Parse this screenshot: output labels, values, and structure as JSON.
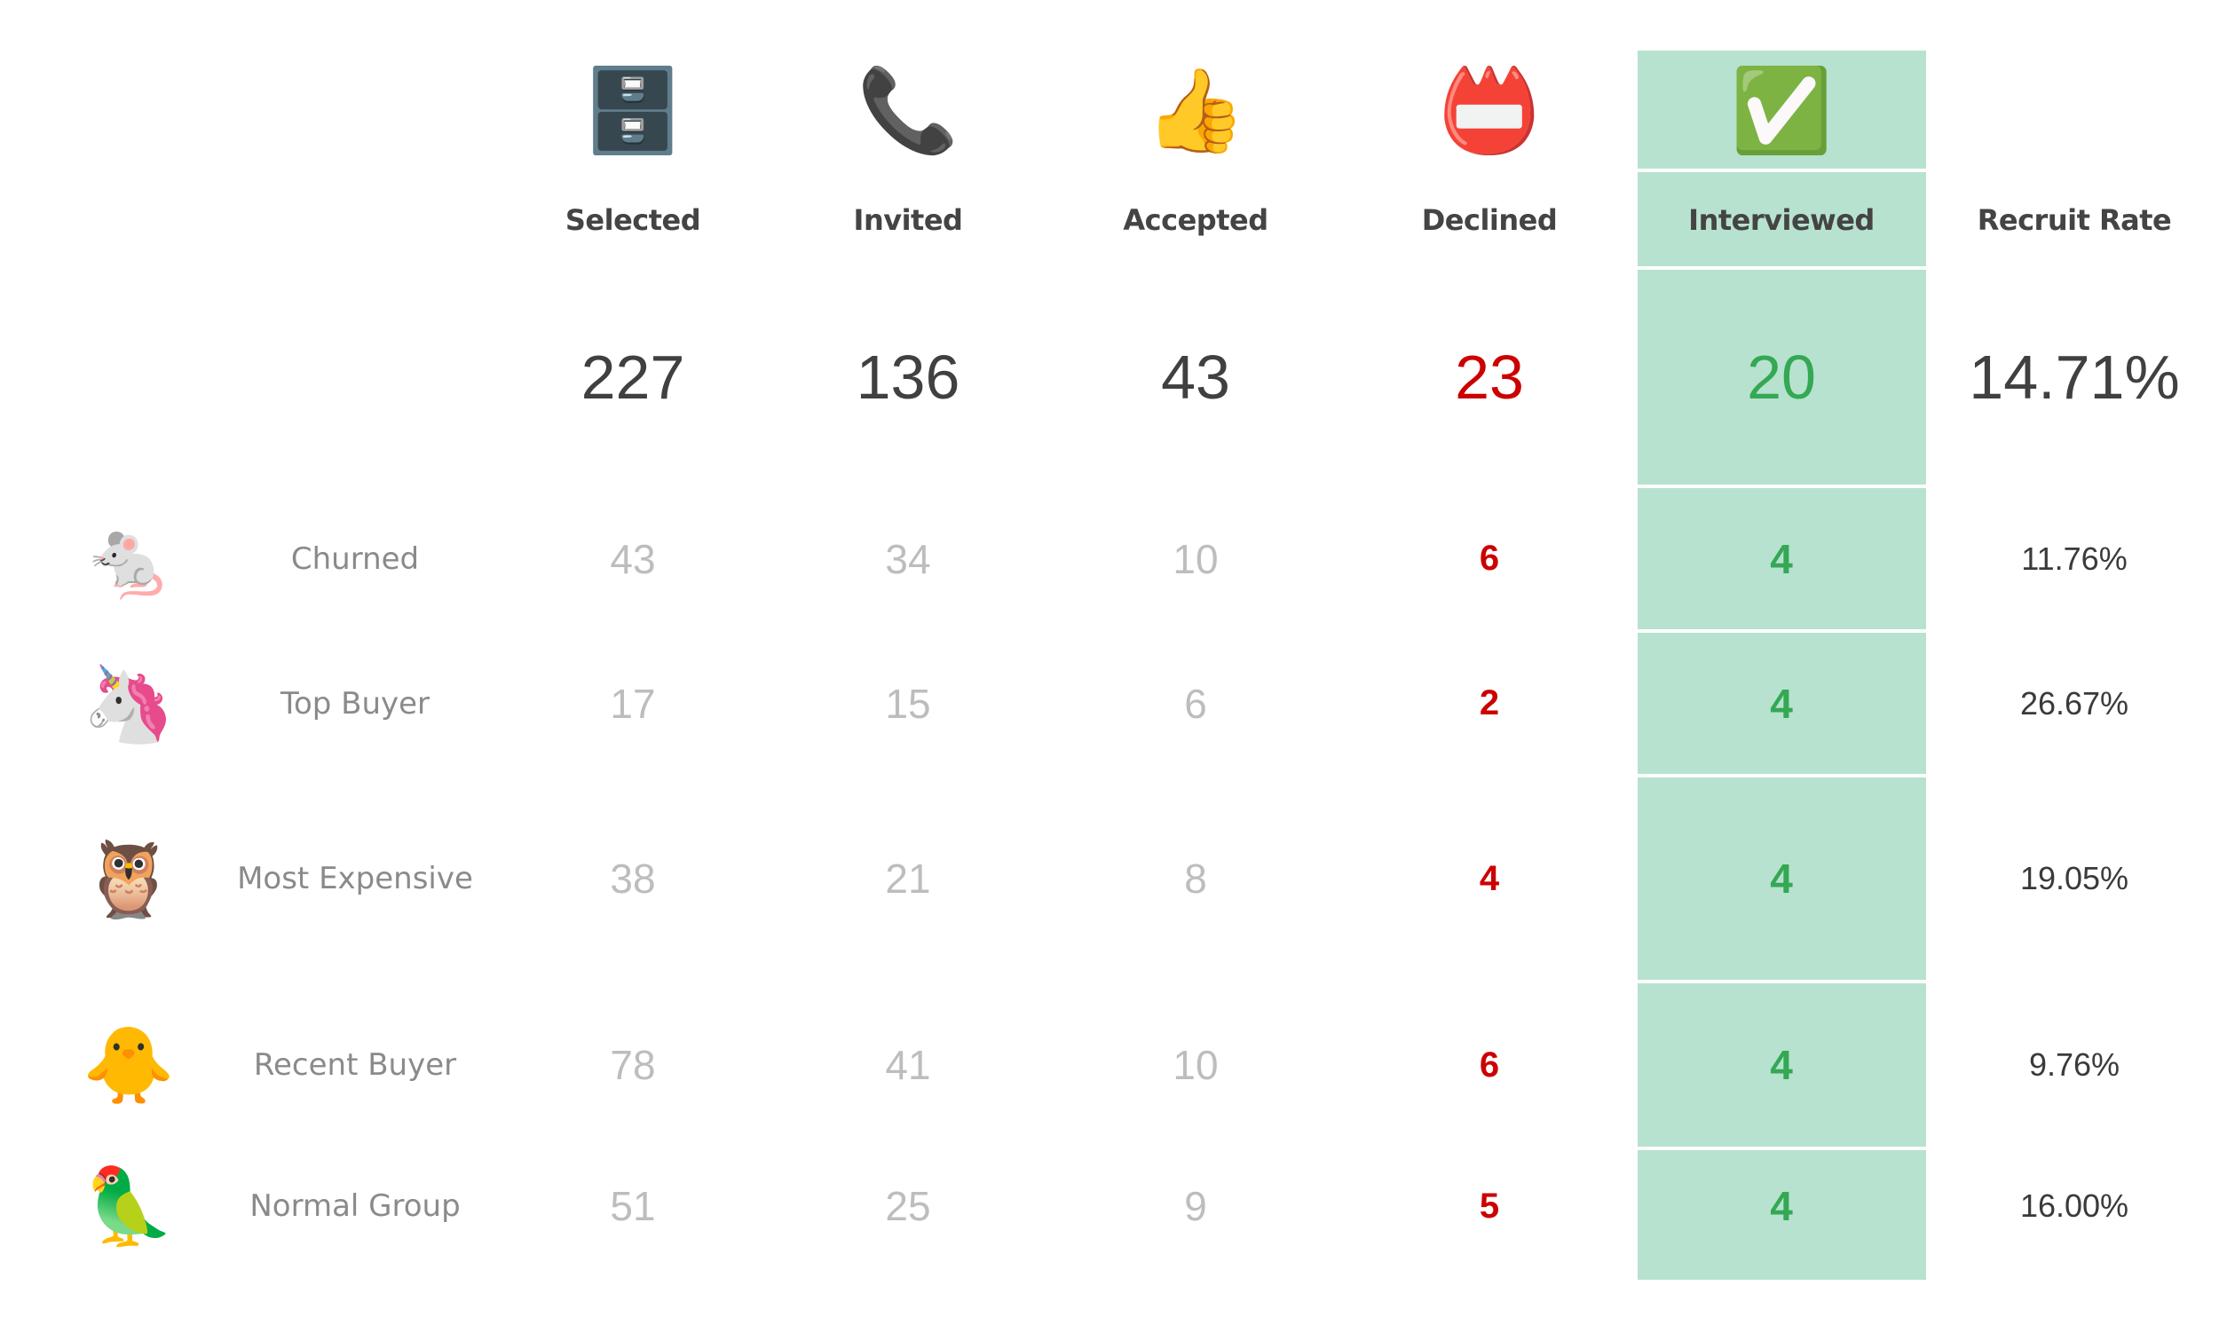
{
  "columns": [
    {
      "key": "selected",
      "label": "Selected",
      "icon": "🗄️",
      "icon_name": "file-cabinet-icon"
    },
    {
      "key": "invited",
      "label": "Invited",
      "icon": "📞",
      "icon_name": "telephone-receiver-icon"
    },
    {
      "key": "accepted",
      "label": "Accepted",
      "icon": "👍",
      "icon_name": "thumbs-up-icon"
    },
    {
      "key": "declined",
      "label": "Declined",
      "icon": "📛",
      "icon_name": "name-badge-icon"
    },
    {
      "key": "interviewed",
      "label": "Interviewed",
      "icon": "✅",
      "icon_name": "check-mark-button-icon"
    },
    {
      "key": "recruit_rate",
      "label": "Recruit Rate"
    }
  ],
  "totals": {
    "selected": "227",
    "invited": "136",
    "accepted": "43",
    "declined": "23",
    "interviewed": "20",
    "recruit_rate": "14.71%"
  },
  "segments": [
    {
      "name": "Churned",
      "icon": "🐁",
      "icon_name": "mouse-icon",
      "selected": "43",
      "invited": "34",
      "accepted": "10",
      "declined": "6",
      "interviewed": "4",
      "recruit_rate": "11.76%"
    },
    {
      "name": "Top Buyer",
      "icon": "🦄",
      "icon_name": "unicorn-icon",
      "selected": "17",
      "invited": "15",
      "accepted": "6",
      "declined": "2",
      "interviewed": "4",
      "recruit_rate": "26.67%"
    },
    {
      "name": "Most Expensive",
      "icon": "🦉",
      "icon_name": "owl-icon",
      "selected": "38",
      "invited": "21",
      "accepted": "8",
      "declined": "4",
      "interviewed": "4",
      "recruit_rate": "19.05%"
    },
    {
      "name": "Recent Buyer",
      "icon": "🐥",
      "icon_name": "baby-chick-icon",
      "selected": "78",
      "invited": "41",
      "accepted": "10",
      "declined": "6",
      "interviewed": "4",
      "recruit_rate": "9.76%"
    },
    {
      "name": "Normal Group",
      "icon": "🦜",
      "icon_name": "parrot-icon",
      "selected": "51",
      "invited": "25",
      "accepted": "9",
      "declined": "5",
      "interviewed": "4",
      "recruit_rate": "16.00%"
    }
  ],
  "colors": {
    "highlight_bg": "#b7e2cf",
    "declined_text": "#cc0000",
    "interviewed_text": "#34a853",
    "muted_text": "#bdbdbd",
    "header_text": "#444444"
  }
}
